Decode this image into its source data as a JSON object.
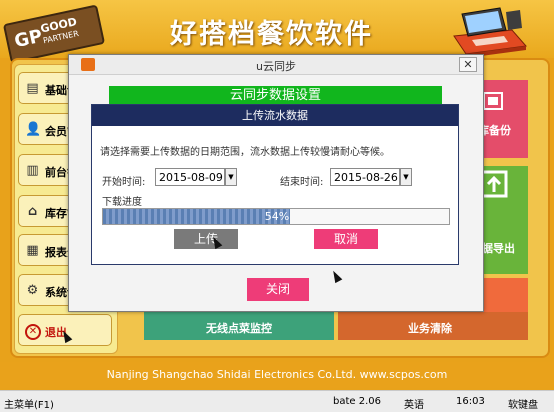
{
  "app": {
    "title": "好搭档餐饮软件",
    "logo": {
      "mark": "GP",
      "line1": "GOOD",
      "line2": "PARTNER"
    }
  },
  "sidebar": {
    "items": [
      {
        "label": "基础设置",
        "icon": "book-icon"
      },
      {
        "label": "会员管理",
        "icon": "user-icon"
      },
      {
        "label": "前台销售",
        "icon": "cash-register-icon"
      },
      {
        "label": "库存管理",
        "icon": "home-icon"
      },
      {
        "label": "报表分析",
        "icon": "report-icon"
      },
      {
        "label": "系统设置",
        "icon": "gear-icon"
      },
      {
        "label": "退出",
        "icon": "close-circle-icon"
      }
    ]
  },
  "tiles": {
    "backup": "库备份",
    "export": "据导出",
    "wireless_monitor": "无线点菜监控",
    "clear": "业务清除"
  },
  "sync_dialog": {
    "title": "u云同步",
    "banner": "云同步数据设置",
    "close_button": "关闭",
    "close_glyph": "✕"
  },
  "upload_dialog": {
    "title": "上传流水数据",
    "hint": "请选择需要上传数据的日期范围，流水数据上传较慢请耐心等候。",
    "start_label": "开始时间:",
    "start_date": "2015-08-09",
    "end_label": "结束时间:",
    "end_date": "2015-08-26",
    "progress_label": "下载进度",
    "progress_percent": 54,
    "progress_text": "54%",
    "upload_button": "上传",
    "cancel_button": "取消"
  },
  "footer": {
    "copyright": "Nanjing Shangchao Shidai Electronics Co.Ltd. www.scpos.com"
  },
  "statusbar": {
    "main_menu": "主菜单(F1)",
    "version": "bate 2.06",
    "ime": "英语",
    "time": "16:03",
    "keyboard": "软键盘"
  }
}
